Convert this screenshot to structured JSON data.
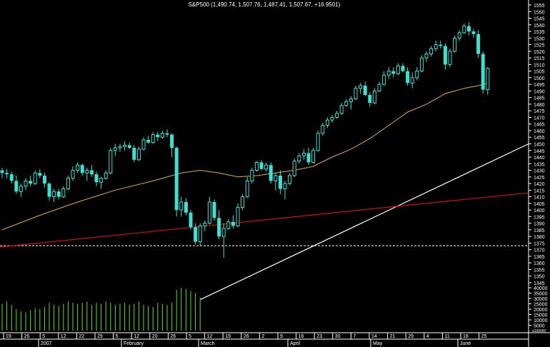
{
  "chart_data": {
    "type": "candlestick",
    "title": "S&P500 (1,490.74, 1,507.76, 1,487.41, 1,507.67, +16.9501)",
    "colors": {
      "background": "#000000",
      "up_candle": "#40e0d0",
      "down_candle": "#40e0d0",
      "moving_average": "#e0b040",
      "trendline_white": "#ffffff",
      "trendline_red": "#d01010",
      "volume": "#66dd22",
      "dashed_line": "#ffffff"
    },
    "price_axis": {
      "min": 1345,
      "max": 1555,
      "ticks": [
        1555,
        1550,
        1545,
        1540,
        1535,
        1530,
        1525,
        1520,
        1515,
        1510,
        1505,
        1500,
        1495,
        1490,
        1485,
        1480,
        1475,
        1470,
        1465,
        1460,
        1455,
        1450,
        1445,
        1440,
        1435,
        1430,
        1425,
        1420,
        1415,
        1410,
        1405,
        1400,
        1395,
        1390,
        1385,
        1380,
        1375,
        1370,
        1365,
        1360,
        1355,
        1350,
        1345
      ]
    },
    "volume_axis": {
      "max": 40000,
      "ticks": [
        40000,
        35000,
        30000,
        25000,
        20000,
        15000,
        10000,
        5000
      ],
      "unit_label": "x100000"
    },
    "x_axis": {
      "day_labels": [
        "19",
        "26",
        "5",
        "12",
        "22",
        "29",
        "5",
        "12",
        "20",
        "26",
        "5",
        "12",
        "19",
        "26",
        "2",
        "9",
        "16",
        "23",
        "30",
        "7",
        "14",
        "21",
        "29",
        "4",
        "11",
        "18",
        "25"
      ],
      "month_labels": [
        "2007",
        "February",
        "March",
        "April",
        "May",
        "June"
      ]
    },
    "dashed_level": 1373,
    "candles": [
      {
        "o": 1430,
        "h": 1432,
        "l": 1424,
        "c": 1428
      },
      {
        "o": 1428,
        "h": 1431,
        "l": 1424,
        "c": 1427
      },
      {
        "o": 1427,
        "h": 1429,
        "l": 1420,
        "c": 1422
      },
      {
        "o": 1422,
        "h": 1426,
        "l": 1412,
        "c": 1414
      },
      {
        "o": 1414,
        "h": 1420,
        "l": 1410,
        "c": 1418
      },
      {
        "o": 1418,
        "h": 1424,
        "l": 1415,
        "c": 1422
      },
      {
        "o": 1422,
        "h": 1426,
        "l": 1418,
        "c": 1420
      },
      {
        "o": 1420,
        "h": 1430,
        "l": 1419,
        "c": 1428
      },
      {
        "o": 1428,
        "h": 1431,
        "l": 1424,
        "c": 1426
      },
      {
        "o": 1426,
        "h": 1428,
        "l": 1417,
        "c": 1420
      },
      {
        "o": 1420,
        "h": 1421,
        "l": 1407,
        "c": 1410
      },
      {
        "o": 1410,
        "h": 1416,
        "l": 1406,
        "c": 1414
      },
      {
        "o": 1414,
        "h": 1416,
        "l": 1408,
        "c": 1410
      },
      {
        "o": 1410,
        "h": 1418,
        "l": 1409,
        "c": 1416
      },
      {
        "o": 1416,
        "h": 1426,
        "l": 1415,
        "c": 1424
      },
      {
        "o": 1424,
        "h": 1433,
        "l": 1422,
        "c": 1430
      },
      {
        "o": 1430,
        "h": 1436,
        "l": 1428,
        "c": 1434
      },
      {
        "o": 1434,
        "h": 1435,
        "l": 1426,
        "c": 1428
      },
      {
        "o": 1428,
        "h": 1432,
        "l": 1422,
        "c": 1430
      },
      {
        "o": 1430,
        "h": 1434,
        "l": 1425,
        "c": 1427
      },
      {
        "o": 1427,
        "h": 1429,
        "l": 1418,
        "c": 1421
      },
      {
        "o": 1421,
        "h": 1425,
        "l": 1416,
        "c": 1424
      },
      {
        "o": 1424,
        "h": 1430,
        "l": 1423,
        "c": 1428
      },
      {
        "o": 1428,
        "h": 1447,
        "l": 1427,
        "c": 1445
      },
      {
        "o": 1445,
        "h": 1450,
        "l": 1441,
        "c": 1447
      },
      {
        "o": 1447,
        "h": 1450,
        "l": 1444,
        "c": 1448
      },
      {
        "o": 1448,
        "h": 1452,
        "l": 1445,
        "c": 1449
      },
      {
        "o": 1449,
        "h": 1451,
        "l": 1446,
        "c": 1447
      },
      {
        "o": 1447,
        "h": 1449,
        "l": 1436,
        "c": 1438
      },
      {
        "o": 1438,
        "h": 1448,
        "l": 1437,
        "c": 1446
      },
      {
        "o": 1446,
        "h": 1455,
        "l": 1445,
        "c": 1453
      },
      {
        "o": 1453,
        "h": 1456,
        "l": 1450,
        "c": 1451
      },
      {
        "o": 1451,
        "h": 1459,
        "l": 1450,
        "c": 1457
      },
      {
        "o": 1457,
        "h": 1459,
        "l": 1452,
        "c": 1455
      },
      {
        "o": 1455,
        "h": 1460,
        "l": 1454,
        "c": 1458
      },
      {
        "o": 1458,
        "h": 1461,
        "l": 1455,
        "c": 1457
      },
      {
        "o": 1457,
        "h": 1458,
        "l": 1440,
        "c": 1447
      },
      {
        "o": 1447,
        "h": 1448,
        "l": 1395,
        "c": 1400
      },
      {
        "o": 1400,
        "h": 1410,
        "l": 1395,
        "c": 1406
      },
      {
        "o": 1406,
        "h": 1409,
        "l": 1396,
        "c": 1398
      },
      {
        "o": 1398,
        "h": 1400,
        "l": 1385,
        "c": 1387
      },
      {
        "o": 1387,
        "h": 1390,
        "l": 1374,
        "c": 1376
      },
      {
        "o": 1376,
        "h": 1390,
        "l": 1373,
        "c": 1388
      },
      {
        "o": 1388,
        "h": 1392,
        "l": 1384,
        "c": 1390
      },
      {
        "o": 1390,
        "h": 1410,
        "l": 1389,
        "c": 1406
      },
      {
        "o": 1406,
        "h": 1408,
        "l": 1392,
        "c": 1394
      },
      {
        "o": 1394,
        "h": 1400,
        "l": 1378,
        "c": 1380
      },
      {
        "o": 1380,
        "h": 1390,
        "l": 1364,
        "c": 1386
      },
      {
        "o": 1386,
        "h": 1393,
        "l": 1385,
        "c": 1391
      },
      {
        "o": 1391,
        "h": 1396,
        "l": 1386,
        "c": 1388
      },
      {
        "o": 1388,
        "h": 1405,
        "l": 1387,
        "c": 1402
      },
      {
        "o": 1402,
        "h": 1412,
        "l": 1400,
        "c": 1410
      },
      {
        "o": 1410,
        "h": 1425,
        "l": 1409,
        "c": 1422
      },
      {
        "o": 1422,
        "h": 1432,
        "l": 1420,
        "c": 1430
      },
      {
        "o": 1430,
        "h": 1437,
        "l": 1429,
        "c": 1436
      },
      {
        "o": 1436,
        "h": 1438,
        "l": 1430,
        "c": 1431
      },
      {
        "o": 1431,
        "h": 1436,
        "l": 1429,
        "c": 1434
      },
      {
        "o": 1434,
        "h": 1436,
        "l": 1420,
        "c": 1422
      },
      {
        "o": 1422,
        "h": 1428,
        "l": 1415,
        "c": 1426
      },
      {
        "o": 1426,
        "h": 1430,
        "l": 1412,
        "c": 1416
      },
      {
        "o": 1416,
        "h": 1422,
        "l": 1408,
        "c": 1420
      },
      {
        "o": 1420,
        "h": 1428,
        "l": 1419,
        "c": 1426
      },
      {
        "o": 1426,
        "h": 1439,
        "l": 1425,
        "c": 1437
      },
      {
        "o": 1437,
        "h": 1443,
        "l": 1435,
        "c": 1441
      },
      {
        "o": 1441,
        "h": 1446,
        "l": 1438,
        "c": 1443
      },
      {
        "o": 1443,
        "h": 1447,
        "l": 1434,
        "c": 1436
      },
      {
        "o": 1436,
        "h": 1447,
        "l": 1435,
        "c": 1445
      },
      {
        "o": 1445,
        "h": 1460,
        "l": 1444,
        "c": 1458
      },
      {
        "o": 1458,
        "h": 1466,
        "l": 1456,
        "c": 1464
      },
      {
        "o": 1464,
        "h": 1470,
        "l": 1462,
        "c": 1468
      },
      {
        "o": 1468,
        "h": 1472,
        "l": 1466,
        "c": 1470
      },
      {
        "o": 1470,
        "h": 1475,
        "l": 1469,
        "c": 1473
      },
      {
        "o": 1473,
        "h": 1481,
        "l": 1472,
        "c": 1479
      },
      {
        "o": 1479,
        "h": 1484,
        "l": 1478,
        "c": 1482
      },
      {
        "o": 1482,
        "h": 1486,
        "l": 1476,
        "c": 1484
      },
      {
        "o": 1484,
        "h": 1494,
        "l": 1483,
        "c": 1492
      },
      {
        "o": 1492,
        "h": 1496,
        "l": 1488,
        "c": 1494
      },
      {
        "o": 1494,
        "h": 1497,
        "l": 1486,
        "c": 1487
      },
      {
        "o": 1487,
        "h": 1489,
        "l": 1478,
        "c": 1481
      },
      {
        "o": 1481,
        "h": 1492,
        "l": 1480,
        "c": 1490
      },
      {
        "o": 1490,
        "h": 1497,
        "l": 1489,
        "c": 1495
      },
      {
        "o": 1495,
        "h": 1505,
        "l": 1494,
        "c": 1502
      },
      {
        "o": 1502,
        "h": 1508,
        "l": 1499,
        "c": 1505
      },
      {
        "o": 1505,
        "h": 1508,
        "l": 1500,
        "c": 1503
      },
      {
        "o": 1503,
        "h": 1511,
        "l": 1502,
        "c": 1509
      },
      {
        "o": 1509,
        "h": 1511,
        "l": 1504,
        "c": 1505
      },
      {
        "o": 1505,
        "h": 1508,
        "l": 1494,
        "c": 1496
      },
      {
        "o": 1496,
        "h": 1504,
        "l": 1492,
        "c": 1500
      },
      {
        "o": 1500,
        "h": 1508,
        "l": 1498,
        "c": 1505
      },
      {
        "o": 1505,
        "h": 1517,
        "l": 1504,
        "c": 1515
      },
      {
        "o": 1515,
        "h": 1520,
        "l": 1512,
        "c": 1518
      },
      {
        "o": 1518,
        "h": 1524,
        "l": 1516,
        "c": 1522
      },
      {
        "o": 1522,
        "h": 1528,
        "l": 1520,
        "c": 1525
      },
      {
        "o": 1525,
        "h": 1528,
        "l": 1522,
        "c": 1524
      },
      {
        "o": 1524,
        "h": 1526,
        "l": 1506,
        "c": 1510
      },
      {
        "o": 1510,
        "h": 1522,
        "l": 1508,
        "c": 1520
      },
      {
        "o": 1520,
        "h": 1532,
        "l": 1519,
        "c": 1530
      },
      {
        "o": 1530,
        "h": 1536,
        "l": 1528,
        "c": 1534
      },
      {
        "o": 1534,
        "h": 1541,
        "l": 1533,
        "c": 1539
      },
      {
        "o": 1539,
        "h": 1542,
        "l": 1532,
        "c": 1535
      },
      {
        "o": 1535,
        "h": 1537,
        "l": 1530,
        "c": 1533
      },
      {
        "o": 1533,
        "h": 1536,
        "l": 1515,
        "c": 1518
      },
      {
        "o": 1518,
        "h": 1520,
        "l": 1488,
        "c": 1491
      },
      {
        "o": 1491,
        "h": 1508,
        "l": 1487,
        "c": 1507
      }
    ],
    "volumes": [
      25000,
      27000,
      24000,
      20000,
      18000,
      17000,
      19000,
      21000,
      20000,
      22000,
      26000,
      24000,
      23000,
      25000,
      27000,
      26000,
      25000,
      26000,
      27000,
      24000,
      26000,
      25000,
      27000,
      26000,
      24000,
      25000,
      26000,
      24000,
      25000,
      27000,
      24000,
      23000,
      22000,
      26000,
      25000,
      24000,
      26000,
      38000,
      40000,
      39000,
      37000,
      35000,
      31000
    ],
    "ma_points": [
      [
        0,
        1385
      ],
      [
        8,
        1396
      ],
      [
        16,
        1406
      ],
      [
        24,
        1415
      ],
      [
        32,
        1422
      ],
      [
        38,
        1428
      ],
      [
        42,
        1430
      ],
      [
        46,
        1428
      ],
      [
        50,
        1425
      ],
      [
        54,
        1426
      ],
      [
        58,
        1428
      ],
      [
        62,
        1430
      ],
      [
        66,
        1433
      ],
      [
        70,
        1440
      ],
      [
        74,
        1446
      ],
      [
        78,
        1454
      ],
      [
        82,
        1464
      ],
      [
        86,
        1474
      ],
      [
        90,
        1480
      ],
      [
        94,
        1488
      ],
      [
        98,
        1492
      ],
      [
        101,
        1494
      ],
      [
        103,
        1496
      ]
    ],
    "white_trendline": [
      [
        23,
        1355
      ],
      [
        103,
        1455
      ]
    ],
    "red_trendline": [
      [
        0,
        1372
      ],
      [
        103,
        1413
      ]
    ]
  }
}
